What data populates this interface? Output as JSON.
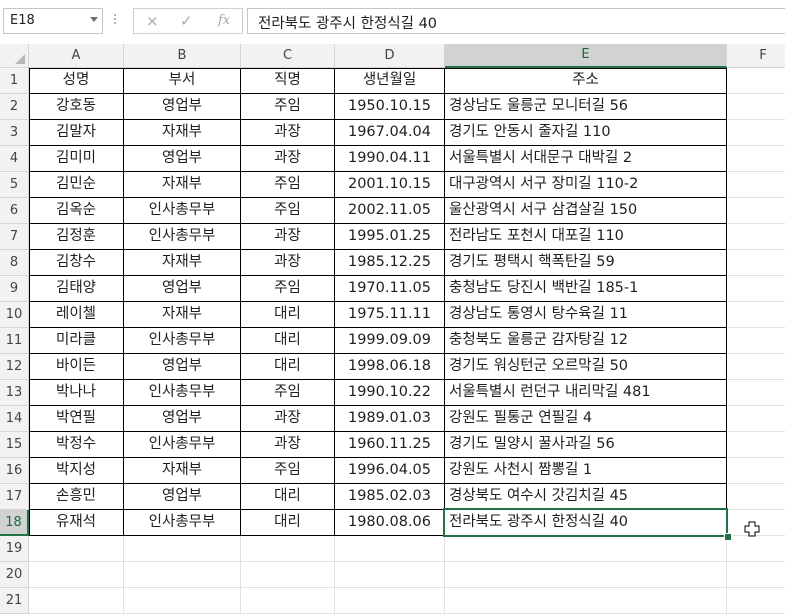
{
  "formula_bar": {
    "name_box": "E18",
    "cancel_icon": "×",
    "enter_icon": "✓",
    "fx_label": "fx",
    "formula": "전라북도 광주시 한정식길 40"
  },
  "columns": [
    "A",
    "B",
    "C",
    "D",
    "E",
    "F"
  ],
  "row_numbers": [
    "1",
    "2",
    "3",
    "4",
    "5",
    "6",
    "7",
    "8",
    "9",
    "10",
    "11",
    "12",
    "13",
    "14",
    "15",
    "16",
    "17",
    "18",
    "19",
    "20",
    "21"
  ],
  "table": {
    "headers": [
      "성명",
      "부서",
      "직명",
      "생년월일",
      "주소"
    ],
    "rows": [
      [
        "강호동",
        "영업부",
        "주임",
        "1950.10.15",
        "경상남도 울릉군 모니터길 56"
      ],
      [
        "김말자",
        "자재부",
        "과장",
        "1967.04.04",
        "경기도 안동시 줄자길 110"
      ],
      [
        "김미미",
        "영업부",
        "과장",
        "1990.04.11",
        "서울특별시 서대문구 대박길 2"
      ],
      [
        "김민순",
        "자재부",
        "주임",
        "2001.10.15",
        "대구광역시 서구 장미길 110-2"
      ],
      [
        "김옥순",
        "인사총무부",
        "주임",
        "2002.11.05",
        "울산광역시 서구 삼겹살길 150"
      ],
      [
        "김정훈",
        "인사총무부",
        "과장",
        "1995.01.25",
        "전라남도 포천시 대포길 110"
      ],
      [
        "김창수",
        "자재부",
        "과장",
        "1985.12.25",
        "경기도 평택시 핵폭탄길 59"
      ],
      [
        "김태양",
        "영업부",
        "주임",
        "1970.11.05",
        "충청남도 당진시 백반길 185-1"
      ],
      [
        "레이첼",
        "자재부",
        "대리",
        "1975.11.11",
        "경상남도 통영시 탕수육길 11"
      ],
      [
        "미라클",
        "인사총무부",
        "대리",
        "1999.09.09",
        "충청북도 울릉군 감자탕길 12"
      ],
      [
        "바이든",
        "영업부",
        "대리",
        "1998.06.18",
        "경기도 워싱턴군 오르막길 50"
      ],
      [
        "박나나",
        "인사총무부",
        "주임",
        "1990.10.22",
        "서울특별시 런던구 내리막길 481"
      ],
      [
        "박연필",
        "영업부",
        "과장",
        "1989.01.03",
        "강원도 필통군 연필길 4"
      ],
      [
        "박정수",
        "인사총무부",
        "과장",
        "1960.11.25",
        "경기도 밀양시 꿀사과길 56"
      ],
      [
        "박지성",
        "자재부",
        "주임",
        "1996.04.05",
        "강원도 사천시 짬뽕길 1"
      ],
      [
        "손흥민",
        "영업부",
        "대리",
        "1985.02.03",
        "경상북도 여수시 갓김치길 45"
      ],
      [
        "유재석",
        "인사총무부",
        "대리",
        "1980.08.06",
        "전라북도 광주시 한정식길 40"
      ]
    ]
  },
  "selected_cell": "E18",
  "accent_color": "#217346"
}
